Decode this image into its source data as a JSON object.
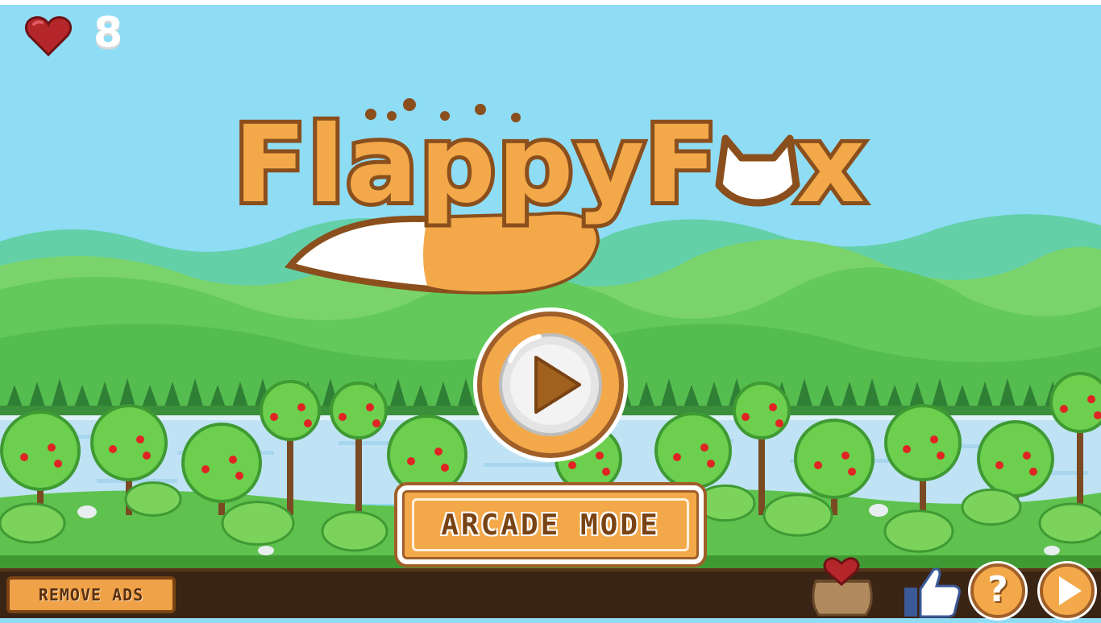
{
  "game": {
    "title_line1": "Flappy",
    "title_line2": "F",
    "title_line3": "x",
    "lives": "8"
  },
  "menu": {
    "play_icon": "play-triangle-icon",
    "arcade_label": "ARCADE MODE",
    "remove_ads_label": "REMOVE ADS"
  },
  "controls": {
    "help_label": "?",
    "like_icon": "thumbs-up-icon",
    "next_icon": "play-icon",
    "shop_icon": "heart-bag-icon"
  },
  "colors": {
    "sky": "#8fdcf5",
    "accent_orange": "#f3a94a",
    "accent_brown": "#a05f28",
    "hill_light": "#62c95a",
    "hill_dark": "#4faa4a",
    "water": "#bfe3f5",
    "soil": "#3a2414"
  }
}
